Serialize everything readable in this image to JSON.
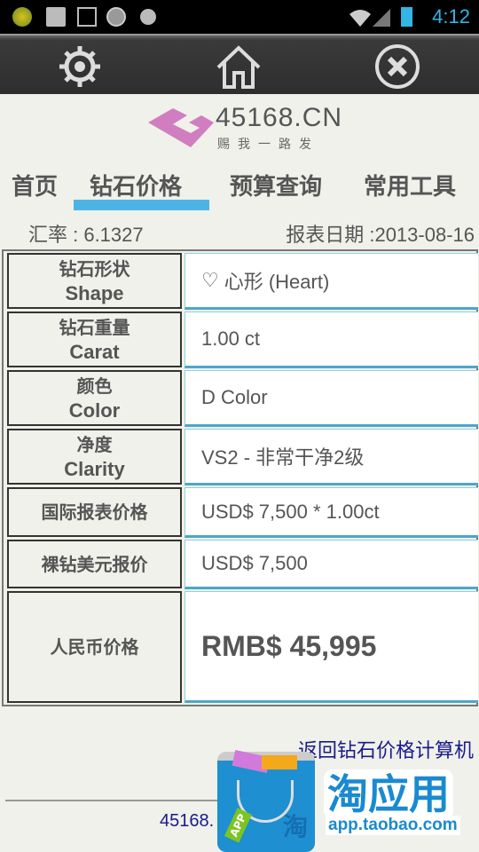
{
  "status_bar": {
    "time": "4:12",
    "icons": [
      "app-icon",
      "microphone-icon",
      "image-icon",
      "app-badge-icon",
      "media-icon",
      "wifi-icon",
      "signal-icon",
      "battery-icon"
    ]
  },
  "toolbar": {
    "buttons": [
      "settings-icon",
      "home-icon",
      "close-icon"
    ]
  },
  "logo": {
    "text": "45168.CN",
    "slogan": "赐我一路发"
  },
  "tabs": [
    {
      "label": "首页"
    },
    {
      "label": "钻石价格",
      "active": true
    },
    {
      "label": "预算查询"
    },
    {
      "label": "常用工具"
    }
  ],
  "info": {
    "rate": "汇率 : 6.1327",
    "date": "报表日期 :2013-08-16"
  },
  "rows": [
    {
      "cn": "钻石形状",
      "en": "Shape",
      "value": "心形 (Heart)"
    },
    {
      "cn": "钻石重量",
      "en": "Carat",
      "value": "1.00 ct"
    },
    {
      "cn": "颜色",
      "en": "Color",
      "value": "D Color"
    },
    {
      "cn": "净度",
      "en": "Clarity",
      "value": "VS2 - 非常干净2级"
    },
    {
      "cn": "国际报表价格",
      "value": "USD$ 7,500 * 1.00ct"
    },
    {
      "cn": "裸钻美元报价",
      "value": "USD$ 7,500"
    },
    {
      "cn": "人民币价格",
      "value": "RMB$ 45,995"
    }
  ],
  "link": "返回钻石价格计算机",
  "footer": "45168.",
  "ad": {
    "title": "淘应用",
    "url": "app.taobao.com",
    "tag": "APP",
    "badge": "淘"
  },
  "colors": {
    "accent": "#4db3e4",
    "link": "#1a1a8a",
    "clock": "#33b5e5"
  }
}
